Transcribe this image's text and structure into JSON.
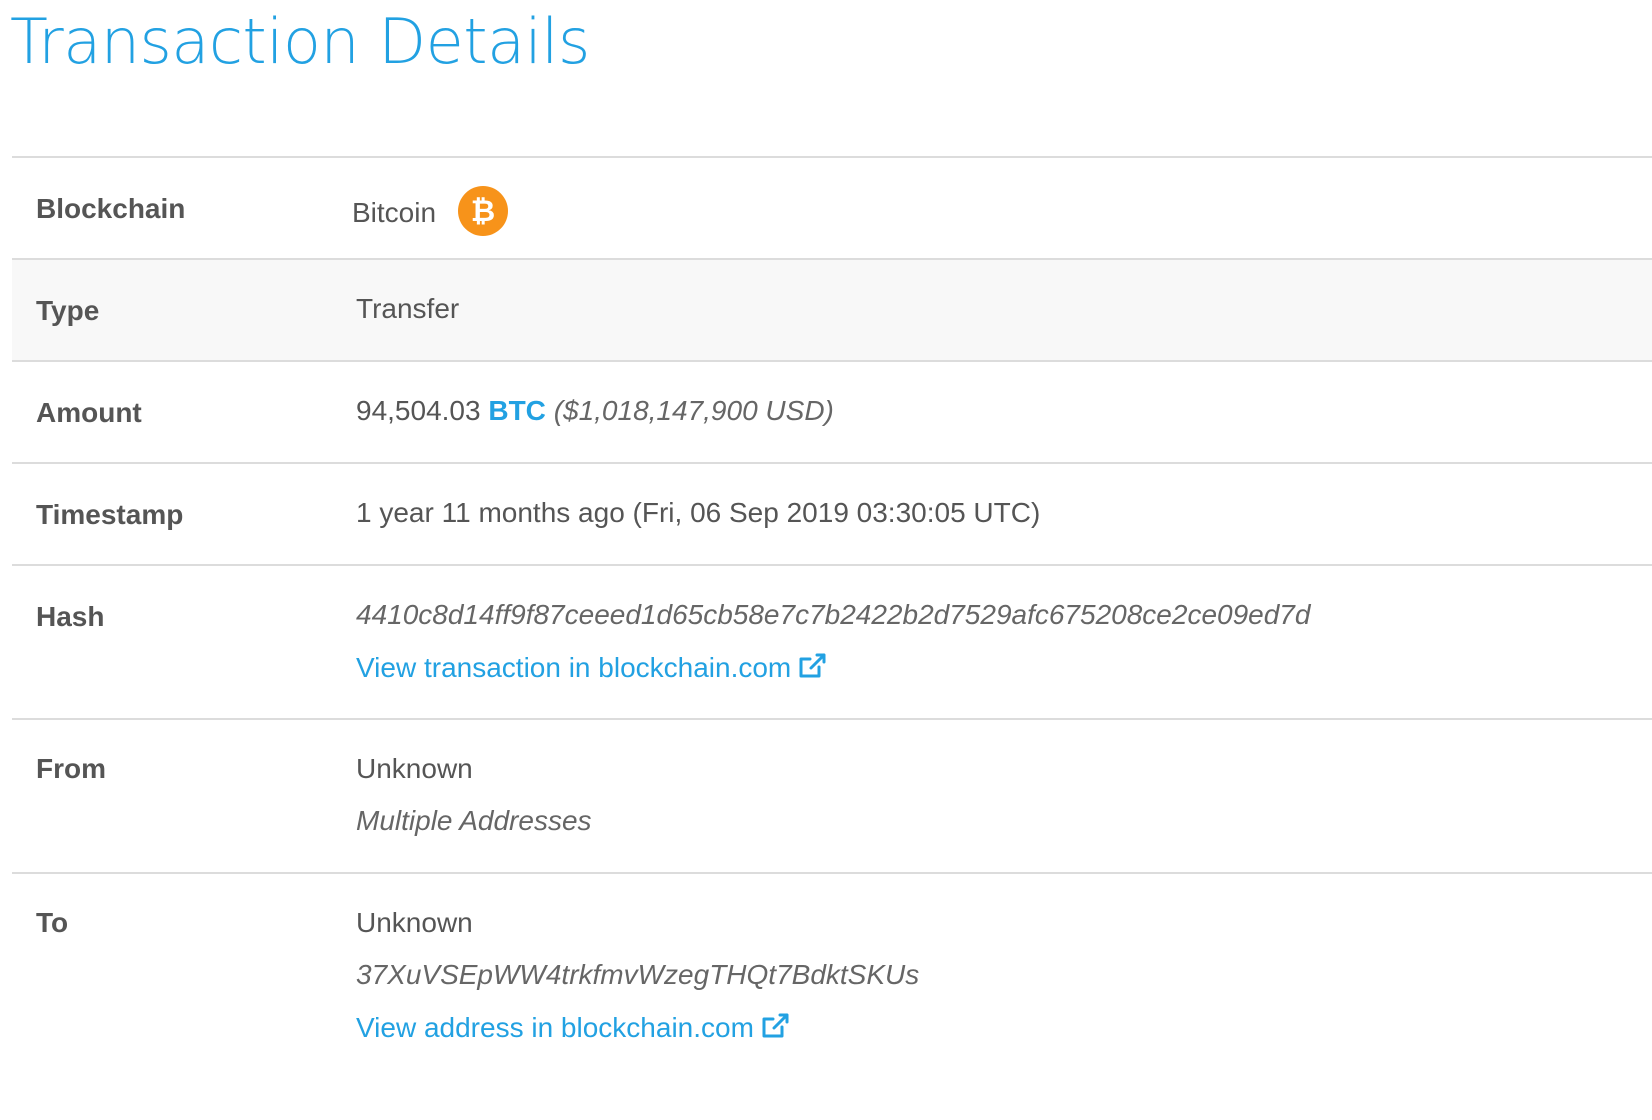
{
  "title": "Transaction Details",
  "rows": {
    "blockchain": {
      "label": "Blockchain",
      "value": "Bitcoin",
      "icon": "bitcoin-icon",
      "icon_color": "#f7931a"
    },
    "type": {
      "label": "Type",
      "value": "Transfer"
    },
    "amount": {
      "label": "Amount",
      "value": "94,504.03",
      "currency": "BTC",
      "usd": "($1,018,147,900 USD)"
    },
    "timestamp": {
      "label": "Timestamp",
      "value": "1 year 11 months ago (Fri, 06 Sep 2019 03:30:05 UTC)"
    },
    "hash": {
      "label": "Hash",
      "value": "4410c8d14ff9f87ceeed1d65cb58e7c7b2422b2d7529afc675208ce2ce09ed7d",
      "link": "View transaction in blockchain.com"
    },
    "from": {
      "label": "From",
      "owner": "Unknown",
      "address": "Multiple Addresses"
    },
    "to": {
      "label": "To",
      "owner": "Unknown",
      "address": "37XuVSEpWW4trkfmvWzegTHQt7BdktSKUs",
      "link": "View address in blockchain.com"
    }
  },
  "colors": {
    "accent": "#22a1e2",
    "label_text": "#555555",
    "border": "#dcdcdc",
    "alt_row_bg": "#f8f8f8"
  }
}
